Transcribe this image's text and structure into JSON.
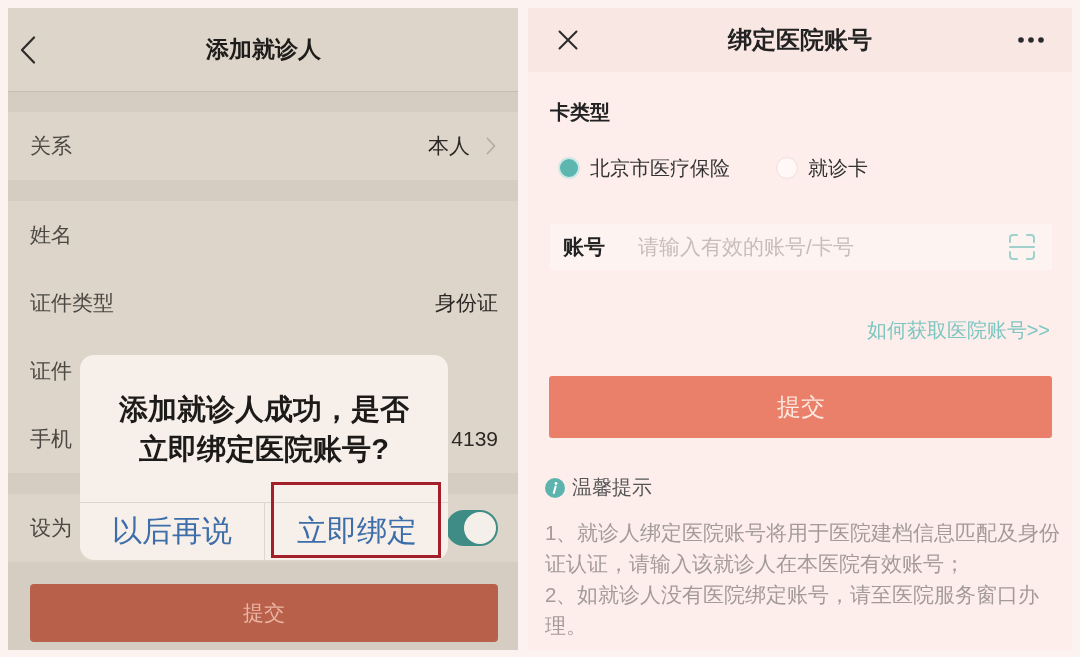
{
  "add_patient_screen": {
    "header": {
      "title": "添加就诊人"
    },
    "groups": [
      {
        "rows": [
          {
            "kind": "select",
            "label": "关系",
            "value": "本人"
          }
        ]
      },
      {
        "rows": [
          {
            "kind": "text",
            "label": "姓名"
          },
          {
            "kind": "text",
            "label": "证件类型",
            "value": "身份证"
          },
          {
            "kind": "text",
            "label": "证件"
          },
          {
            "kind": "text",
            "label": "手机",
            "value": "4139"
          }
        ]
      },
      {
        "rows": [
          {
            "kind": "switch",
            "label": "设为",
            "on": true
          }
        ]
      }
    ],
    "submit_button": {
      "label": "提交"
    },
    "dialog": {
      "message": "添加就诊人成功，是否立即绑定医院账号?",
      "buttons": [
        {
          "label": "以后再说",
          "highlighted": false
        },
        {
          "label": "立即绑定",
          "highlighted": true
        }
      ]
    }
  },
  "bind_account_screen": {
    "header": {
      "title": "绑定医院账号"
    },
    "card_type": {
      "label": "卡类型",
      "options": [
        {
          "label": "北京市医疗保险",
          "selected": true
        },
        {
          "label": "就诊卡",
          "selected": false
        }
      ]
    },
    "account_field": {
      "label": "账号",
      "placeholder": "请输入有效的账号/卡号"
    },
    "help_link": "如何获取医院账号>>",
    "submit_button": {
      "label": "提交"
    },
    "tips": {
      "title": "温馨提示",
      "items": [
        "1、就诊人绑定医院账号将用于医院建档信息匹配及身份证认证，请输入该就诊人在本医院有效账号；",
        "2、如就诊人没有医院绑定账号，请至医院服务窗口办理。"
      ]
    }
  }
}
